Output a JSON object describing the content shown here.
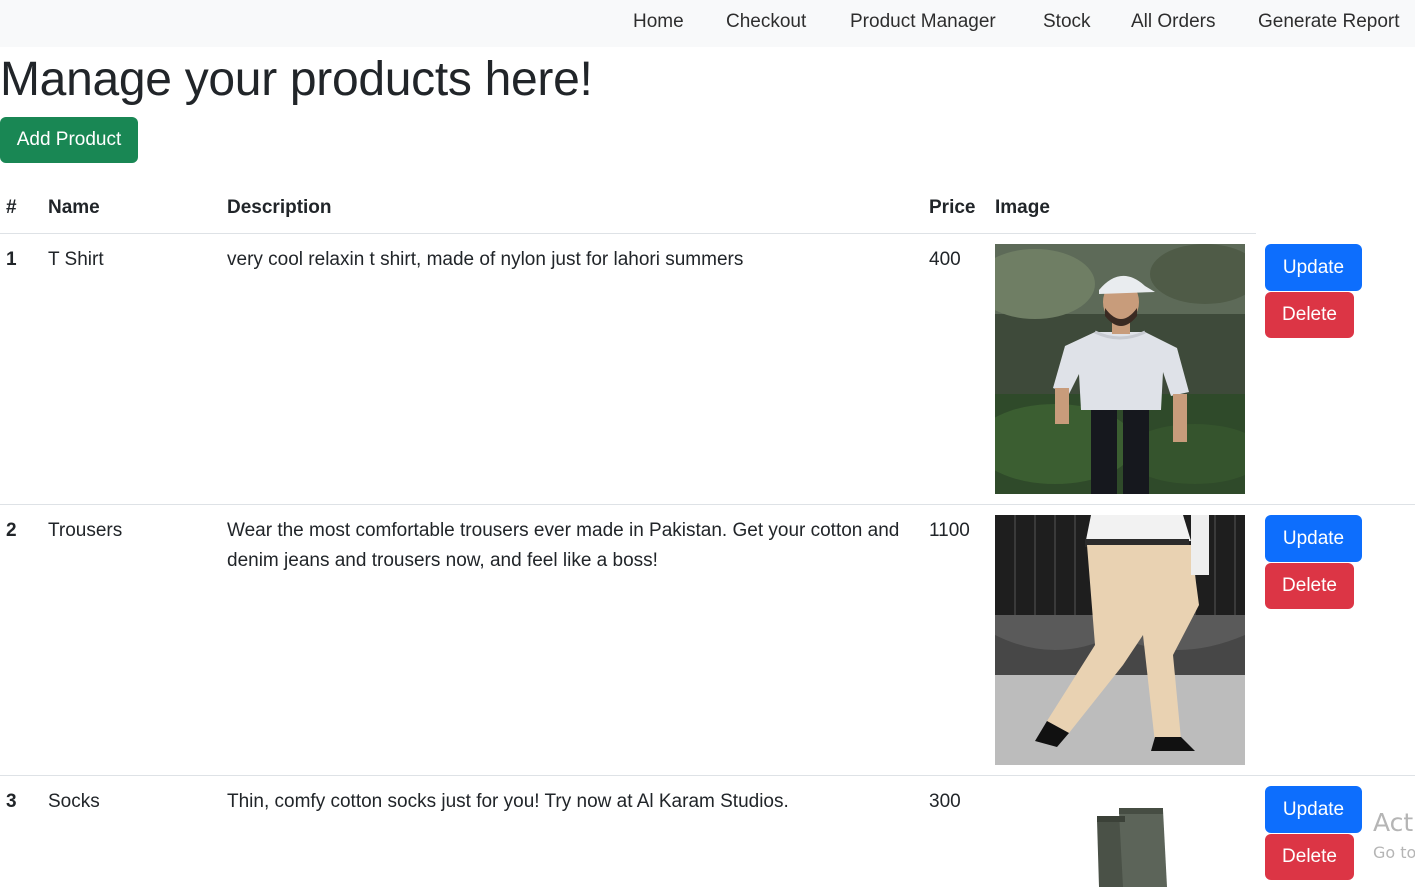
{
  "nav": {
    "items": [
      "Home",
      "Checkout",
      "Product Manager",
      "Stock",
      "All Orders",
      "Generate Report"
    ]
  },
  "page": {
    "title": "Manage your products here!",
    "add_button": "Add Product"
  },
  "table": {
    "headers": [
      "#",
      "Name",
      "Description",
      "Price",
      "Image"
    ],
    "update_label": "Update",
    "delete_label": "Delete",
    "rows": [
      {
        "num": "1",
        "name": "T Shirt",
        "description": "very cool relaxin t shirt, made of nylon just for lahori summers",
        "price": "400"
      },
      {
        "num": "2",
        "name": "Trousers",
        "description": "Wear the most comfortable trousers ever made in Pakistan. Get your cotton and denim jeans and trousers now, and feel like a boss!",
        "price": "1100"
      },
      {
        "num": "3",
        "name": "Socks",
        "description": "Thin, comfy cotton socks just for you! Try now at Al Karam Studios.",
        "price": "300"
      }
    ]
  },
  "watermark": {
    "line1": "Acti",
    "line2": "Go to"
  },
  "colors": {
    "success": "#198754",
    "primary": "#0d6efd",
    "danger": "#dc3545",
    "navbar_bg": "#f8f9fa"
  }
}
